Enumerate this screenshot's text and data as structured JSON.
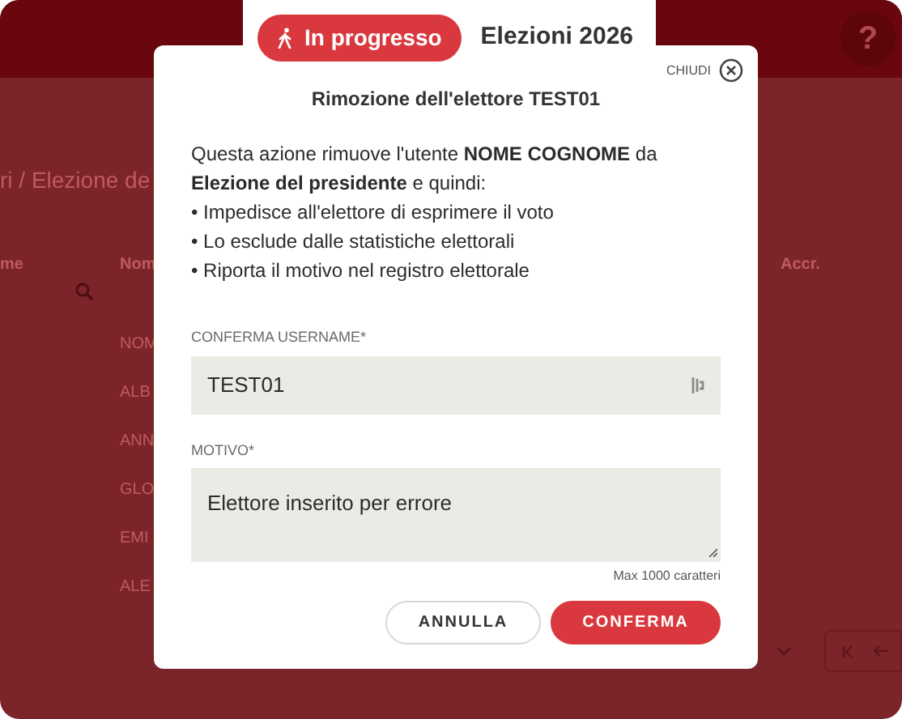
{
  "header": {
    "help": "?"
  },
  "status": {
    "label": "In progresso",
    "election": "Elezioni 2026"
  },
  "background": {
    "breadcrumb": "ri / Elezione de",
    "columns": [
      "me",
      "Nom",
      "Accr."
    ],
    "rows": [
      "NOM",
      "ALB",
      "ANN",
      "GLO",
      "EMI",
      "ALE"
    ]
  },
  "dialog": {
    "close_label": "CHIUDI",
    "title": "Rimozione dell'elettore TEST01",
    "message": "Questa azione rimuove l'utente **NOME COGNOME** da **Elezione del presidente** e quindi:",
    "bullets": [
      "• Impedisce all'elettore di esprimere il voto",
      "• Lo esclude dalle statistiche elettorali",
      "• Riporta il motivo nel registro elettorale"
    ],
    "fields": [
      {
        "kind": "input",
        "label": "CONFERMA USERNAME*",
        "value": "TEST01"
      },
      {
        "kind": "textarea",
        "label": "MOTIVO*",
        "value": "Elettore inserito per errore",
        "hint": "Max 1000 caratteri"
      }
    ],
    "buttons": [
      {
        "kind": "secondary",
        "label": "ANNULLA"
      },
      {
        "kind": "primary",
        "label": "CONFERMA"
      }
    ]
  }
}
